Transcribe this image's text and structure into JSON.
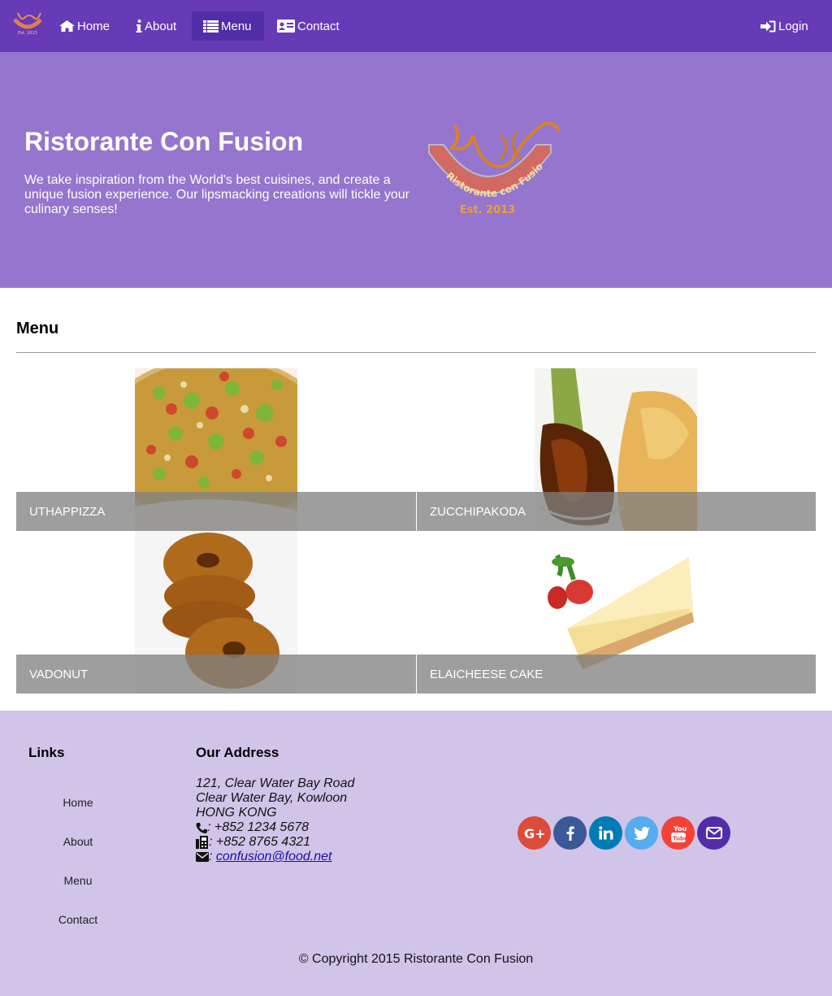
{
  "nav": {
    "home": "Home",
    "about": "About",
    "menu": "Menu",
    "contact": "Contact",
    "login": "Login"
  },
  "jumbotron": {
    "title": "Ristorante Con Fusion",
    "text": "We take inspiration from the World's best cuisines, and create a unique fusion experience. Our lipsmacking creations will tickle your culinary senses!",
    "logo_text": "Ristorante con Fusion",
    "logo_est": "Est. 2013"
  },
  "menu": {
    "heading": "Menu",
    "items": [
      {
        "name": "Uthappizza"
      },
      {
        "name": "Zucchipakoda"
      },
      {
        "name": "Vadonut"
      },
      {
        "name": "ElaiCheese Cake"
      }
    ]
  },
  "footer": {
    "links_title": "Links",
    "links": [
      "Home",
      "About",
      "Menu",
      "Contact"
    ],
    "address_title": "Our Address",
    "address": [
      "121, Clear Water Bay Road",
      "Clear Water Bay, Kowloon",
      "HONG KONG"
    ],
    "phone": "+852 1234 5678",
    "fax": "+852 8765 4321",
    "email": "confusion@food.net",
    "copyright": "© Copyright 2015 Ristorante Con Fusion"
  },
  "social": [
    {
      "icon": "google-plus-icon",
      "label": "G+",
      "color": "#dd4b39"
    },
    {
      "icon": "facebook-icon",
      "label": "f",
      "color": "#3b5998"
    },
    {
      "icon": "linkedin-icon",
      "label": "in",
      "color": "#007bb6"
    },
    {
      "icon": "twitter-icon",
      "label": "t",
      "color": "#55acee"
    },
    {
      "icon": "youtube-icon",
      "label": "You Tube",
      "color": "#f44336"
    },
    {
      "icon": "mail-icon",
      "label": "mail",
      "color": "#512da8"
    }
  ],
  "colors": {
    "navbar": "#673ab7",
    "nav_active": "#512da8",
    "jumbotron": "#9575cd",
    "footer": "#d1c4e9"
  }
}
